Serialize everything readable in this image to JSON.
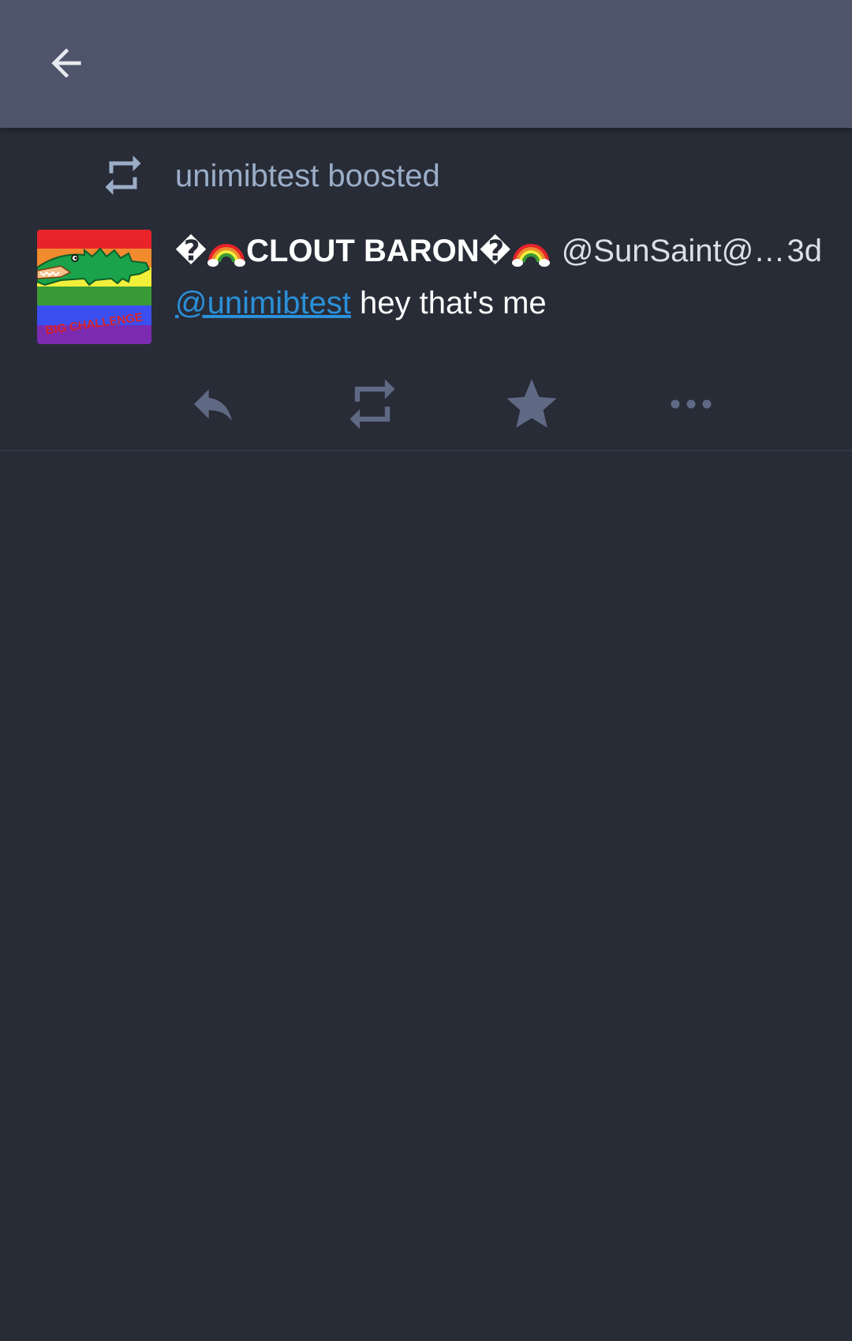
{
  "colors": {
    "background": "#282c37",
    "toolbar": "#4e5469",
    "muted_text": "#9baec8",
    "action_icon": "#606984",
    "mention": "#2b90d9"
  },
  "toolbar": {
    "back_icon": "arrow-left-icon"
  },
  "status": {
    "boosted_by": "unimibtest boosted",
    "boost_icon": "boost-icon",
    "author": {
      "display_name_prefix": "�",
      "display_name": "CLOUT BARON",
      "display_name_suffix": "�",
      "emoji_name": "rainbow-emoji",
      "username": "@SunSaint@wit…",
      "avatar_text": "BIG CHALLENGE"
    },
    "timestamp": "3d",
    "content": {
      "mention": "@unimibtest",
      "text": " hey that's me"
    },
    "actions": {
      "reply_icon": "reply-icon",
      "boost_icon": "boost-icon",
      "favourite_icon": "star-icon",
      "more_icon": "more-icon"
    }
  }
}
